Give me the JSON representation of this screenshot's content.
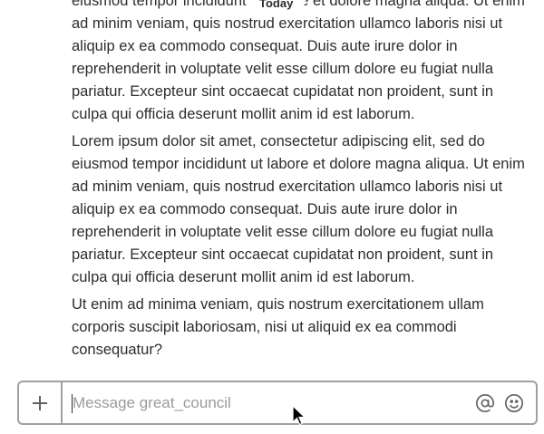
{
  "chat": {
    "day_divider": "Today",
    "messages": [
      "eiusmod tempor incididunt ut labore et dolore magna aliqua. Ut enim ad minim veniam, quis nostrud exercitation ullamco laboris nisi ut aliquip ex ea commodo consequat. Duis aute irure dolor in reprehenderit in voluptate velit esse cillum dolore eu fugiat nulla pariatur. Excepteur sint occaecat cupidatat non proident, sunt in culpa qui officia deserunt mollit anim id est laborum.",
      "Lorem ipsum dolor sit amet, consectetur adipiscing elit, sed do eiusmod tempor incididunt ut labore et dolore magna aliqua. Ut enim ad minim veniam, quis nostrud exercitation ullamco laboris nisi ut aliquip ex ea commodo consequat. Duis aute irure dolor in reprehenderit in voluptate velit esse cillum dolore eu fugiat nulla pariatur. Excepteur sint occaecat cupidatat non proident, sunt in culpa qui officia deserunt mollit anim id est laborum.",
      "Ut enim ad minima veniam, quis nostrum exercitationem ullam corporis suscipit laboriosam, nisi ut aliquid ex ea commodi consequatur?"
    ]
  },
  "composer": {
    "placeholder": "Message great_council",
    "value": "",
    "icons": {
      "add": "plus-icon",
      "mention": "at-sign-icon",
      "emoji": "smiley-icon"
    },
    "icon_color": "#616061",
    "border_color": "#a0a0a2"
  }
}
